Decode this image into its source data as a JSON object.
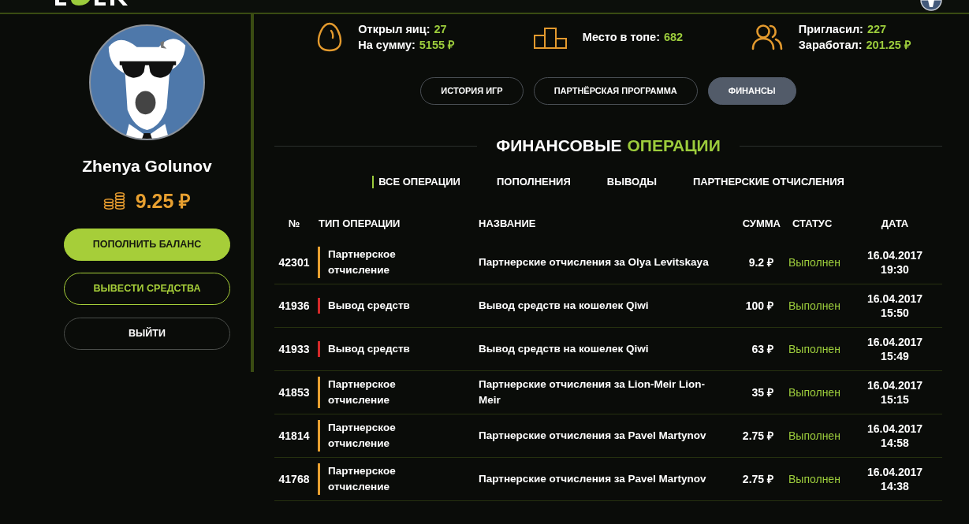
{
  "profile": {
    "name": "Zhenya Golunov",
    "balance": "9.25 ₽",
    "buttons": [
      {
        "label": "ПОПОЛНИТЬ БАЛАНС",
        "kind": "primary"
      },
      {
        "label": "ВЫВЕСТИ СРЕДСТВА",
        "kind": "outline"
      },
      {
        "label": "ВЫЙТИ",
        "kind": "plain"
      }
    ]
  },
  "stats": [
    {
      "kind": "eggs",
      "lines": [
        {
          "label": "Открыл яиц:",
          "value": "27"
        },
        {
          "label": "На сумму:",
          "value": "5155 ₽"
        }
      ]
    },
    {
      "kind": "rank",
      "lines": [
        {
          "label": "Место в топе:",
          "value": "682"
        }
      ]
    },
    {
      "kind": "referrals",
      "lines": [
        {
          "label": "Пригласил:",
          "value": "227"
        },
        {
          "label": "Заработал:",
          "value": "201.25 ₽"
        }
      ]
    }
  ],
  "sections": [
    {
      "label": "ИСТОРИЯ ИГР",
      "selected": false
    },
    {
      "label": "ПАРТНЁРСКАЯ ПРОГРАММА",
      "selected": false
    },
    {
      "label": "ФИНАНСЫ",
      "selected": true
    }
  ],
  "heading": {
    "text": "ФИНАНСОВЫЕ",
    "accent": "ОПЕРАЦИИ"
  },
  "filters": [
    {
      "label": "ВСЕ ОПЕРАЦИИ",
      "selected": true
    },
    {
      "label": "ПОПОЛНЕНИЯ",
      "selected": false
    },
    {
      "label": "ВЫВОДЫ",
      "selected": false
    },
    {
      "label": "ПАРТНЕРСКИЕ ОТЧИСЛЕНИЯ",
      "selected": false
    }
  ],
  "table": {
    "columns": [
      "№",
      "ТИП ОПЕРАЦИИ",
      "НАЗВАНИЕ",
      "СУММА",
      "СТАТУС",
      "ДАТА"
    ],
    "rows": [
      {
        "number": "42301",
        "type": "Партнерское отчисление",
        "color": "#e8a030",
        "name": "Партнерские отчисления за Olya Levitskaya",
        "amount": "9.2 ₽",
        "status": "Выполнен",
        "date": "16.04.2017",
        "time": "19:30"
      },
      {
        "number": "41936",
        "type": "Вывод средств",
        "color": "#d42a2a",
        "name": "Вывод средств на кошелек Qiwi",
        "amount": "100 ₽",
        "status": "Выполнен",
        "date": "16.04.2017",
        "time": "15:50"
      },
      {
        "number": "41933",
        "type": "Вывод средств",
        "color": "#d42a2a",
        "name": "Вывод средств на кошелек Qiwi",
        "amount": "63 ₽",
        "status": "Выполнен",
        "date": "16.04.2017",
        "time": "15:49"
      },
      {
        "number": "41853",
        "type": "Партнерское отчисление",
        "color": "#e8a030",
        "name": "Партнерские отчисления за Lion-Meir Lion-Meir",
        "amount": "35 ₽",
        "status": "Выполнен",
        "date": "16.04.2017",
        "time": "15:15"
      },
      {
        "number": "41814",
        "type": "Партнерское отчисление",
        "color": "#e8a030",
        "name": "Партнерские отчисления за Pavel Martynov",
        "amount": "2.75 ₽",
        "status": "Выполнен",
        "date": "16.04.2017",
        "time": "14:58"
      },
      {
        "number": "41768",
        "type": "Партнерское отчисление",
        "color": "#e8a030",
        "name": "Партнерские отчисления за Pavel Martynov",
        "amount": "2.75 ₽",
        "status": "Выполнен",
        "date": "16.04.2017",
        "time": "14:38"
      }
    ]
  }
}
